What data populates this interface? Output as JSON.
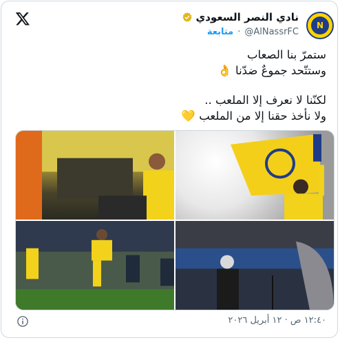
{
  "account": {
    "display_name": "نادي النصر السعودي",
    "handle": "@AlNassrFC",
    "follow_label": "متابعة",
    "separator": "·",
    "avatar_text": "N"
  },
  "tweet": {
    "lines": [
      "ستمرّ بنا الصعاب",
      "وستتّحد جموعٌ ضدّنا 👌",
      "",
      "لكنّنا لا نعرف إلا الملعب ..",
      "ولا نأخذ حقنا إلا من الملعب 💛"
    ]
  },
  "media": {
    "photos": [
      {
        "subject": "player-in-yellow-jersey-number-7"
      },
      {
        "subject": "yellow-club-flag-waving"
      },
      {
        "subject": "players-in-match-action"
      },
      {
        "subject": "coach-on-sideline"
      }
    ]
  },
  "footer": {
    "timestamp": "١٢:٤٠ ص · ١٢ أبريل ٢٠٢٦"
  },
  "colors": {
    "link": "#1d9bf0",
    "secondary_text": "#536471",
    "verified_badge": "#e2b719",
    "club_yellow": "#ffd400",
    "club_blue": "#1f3c88"
  },
  "icons": [
    "x-logo-icon",
    "verified-badge-icon",
    "info-icon"
  ]
}
